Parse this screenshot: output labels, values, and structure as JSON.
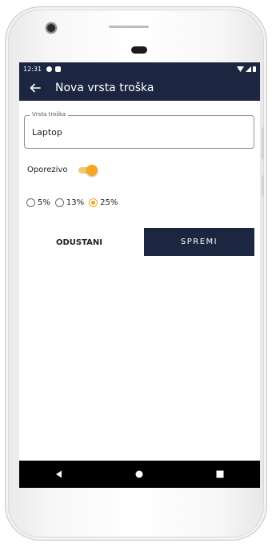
{
  "status_bar": {
    "time": "12:31"
  },
  "app_bar": {
    "title": "Nova vrsta troška"
  },
  "form": {
    "field_label": "Vrsta troška",
    "field_value": "Laptop",
    "toggle_label": "Oporezivo",
    "toggle_on": true,
    "tax_options": [
      {
        "label": "5%",
        "checked": false
      },
      {
        "label": "13%",
        "checked": false
      },
      {
        "label": "25%",
        "checked": true
      }
    ]
  },
  "actions": {
    "cancel_label": "ODUSTANI",
    "save_label": "SPREMI"
  },
  "colors": {
    "primary": "#1d2640",
    "accent": "#f5a623"
  },
  "icons": {
    "back": "arrow-left-icon",
    "nav_back": "triangle-left-icon",
    "nav_home": "circle-icon",
    "nav_recents": "square-icon"
  }
}
